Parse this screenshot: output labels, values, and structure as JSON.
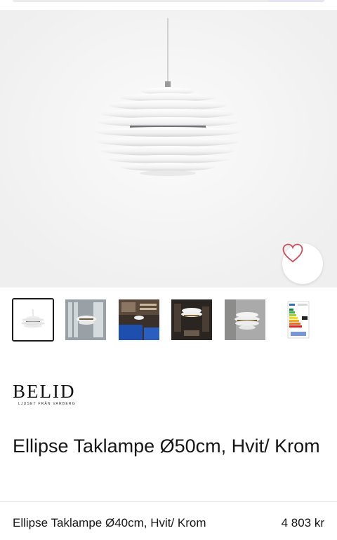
{
  "product": {
    "brand_name": "BELID",
    "brand_tagline": "LJUSET FRÅN VARBERG",
    "title": "Ellipse Taklampe Ø50cm, Hvit/ Krom"
  },
  "gallery": {
    "main_image": "pendant-lamp-photo",
    "favorite_icon": "heart-icon",
    "thumbnails": [
      {
        "name": "thumb-lamp-white",
        "active": true
      },
      {
        "name": "thumb-lamp-window"
      },
      {
        "name": "thumb-livingroom-blue-sofa"
      },
      {
        "name": "thumb-lamp-dark-room"
      },
      {
        "name": "thumb-lamp-closeup"
      },
      {
        "name": "thumb-energy-label"
      }
    ]
  },
  "sticky_bar": {
    "variant_label": "Ellipse Taklampe Ø40cm, Hvit/ Krom",
    "price": "4 803 kr"
  },
  "colors": {
    "accent_heart": "#c94f5c",
    "text": "#161616",
    "hero_bg": "#f4f4f4"
  }
}
